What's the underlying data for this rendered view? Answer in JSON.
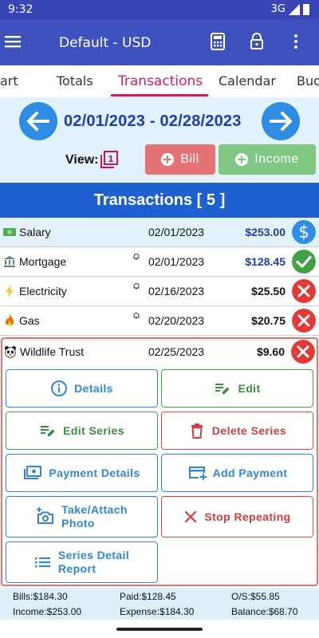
{
  "status_bar": {
    "time": "9:32",
    "network": "3G"
  },
  "app_bar": {
    "title": "Default - USD"
  },
  "tabs": [
    "art",
    "Totals",
    "Transactions",
    "Calendar",
    "Bud"
  ],
  "range": {
    "text": "02/01/2023 - 02/28/2023",
    "view_label": "View:",
    "view_value": "1"
  },
  "actions": {
    "bill": "Bill",
    "income": "Income"
  },
  "header": {
    "title": "Transactions [ 5 ]"
  },
  "transactions": [
    {
      "icon": "money-icon",
      "name": "Salary",
      "date": "02/01/2023",
      "amount": "$253.00",
      "amount_color": "#1a3fb5",
      "status": "dollar"
    },
    {
      "icon": "bank-icon",
      "name": "Mortgage",
      "date": "02/01/2023",
      "amount": "$128.45",
      "amount_color": "#1a3fb5",
      "status": "check",
      "bell": true
    },
    {
      "icon": "lightning-icon",
      "name": "Electricity",
      "date": "02/16/2023",
      "amount": "$25.50",
      "amount_color": "#111111",
      "status": "x",
      "bell": true
    },
    {
      "icon": "fire-icon",
      "name": "Gas",
      "date": "02/20/2023",
      "amount": "$20.75",
      "amount_color": "#111111",
      "status": "x",
      "bell": true
    },
    {
      "icon": "panda-icon",
      "name": "Wildlife Trust",
      "date": "02/25/2023",
      "amount": "$9.60",
      "amount_color": "#111111",
      "status": "x"
    }
  ],
  "detail_buttons": {
    "details": "Details",
    "edit": "Edit",
    "edit_series": "Edit Series",
    "delete_series": "Delete Series",
    "payment_details": "Payment Details",
    "add_payment": "Add Payment",
    "take_photo_line1": "Take/Attach",
    "take_photo_line2": "Photo",
    "stop_repeating": "Stop Repeating",
    "series_report_line1": "Series Detail",
    "series_report_line2": "Report"
  },
  "footer": {
    "bills": "Bills:$184.30",
    "paid": "Paid:$128.45",
    "os": "O/S:$55.85",
    "income": "Income:$253.00",
    "expense": "Expense:$184.30",
    "balance": "Balance:$68.70"
  },
  "colors": {
    "primary": "#3f51c1",
    "accent": "#d81b60",
    "header": "#1e5fd1",
    "bill": "#e57373",
    "income": "#81c784"
  }
}
